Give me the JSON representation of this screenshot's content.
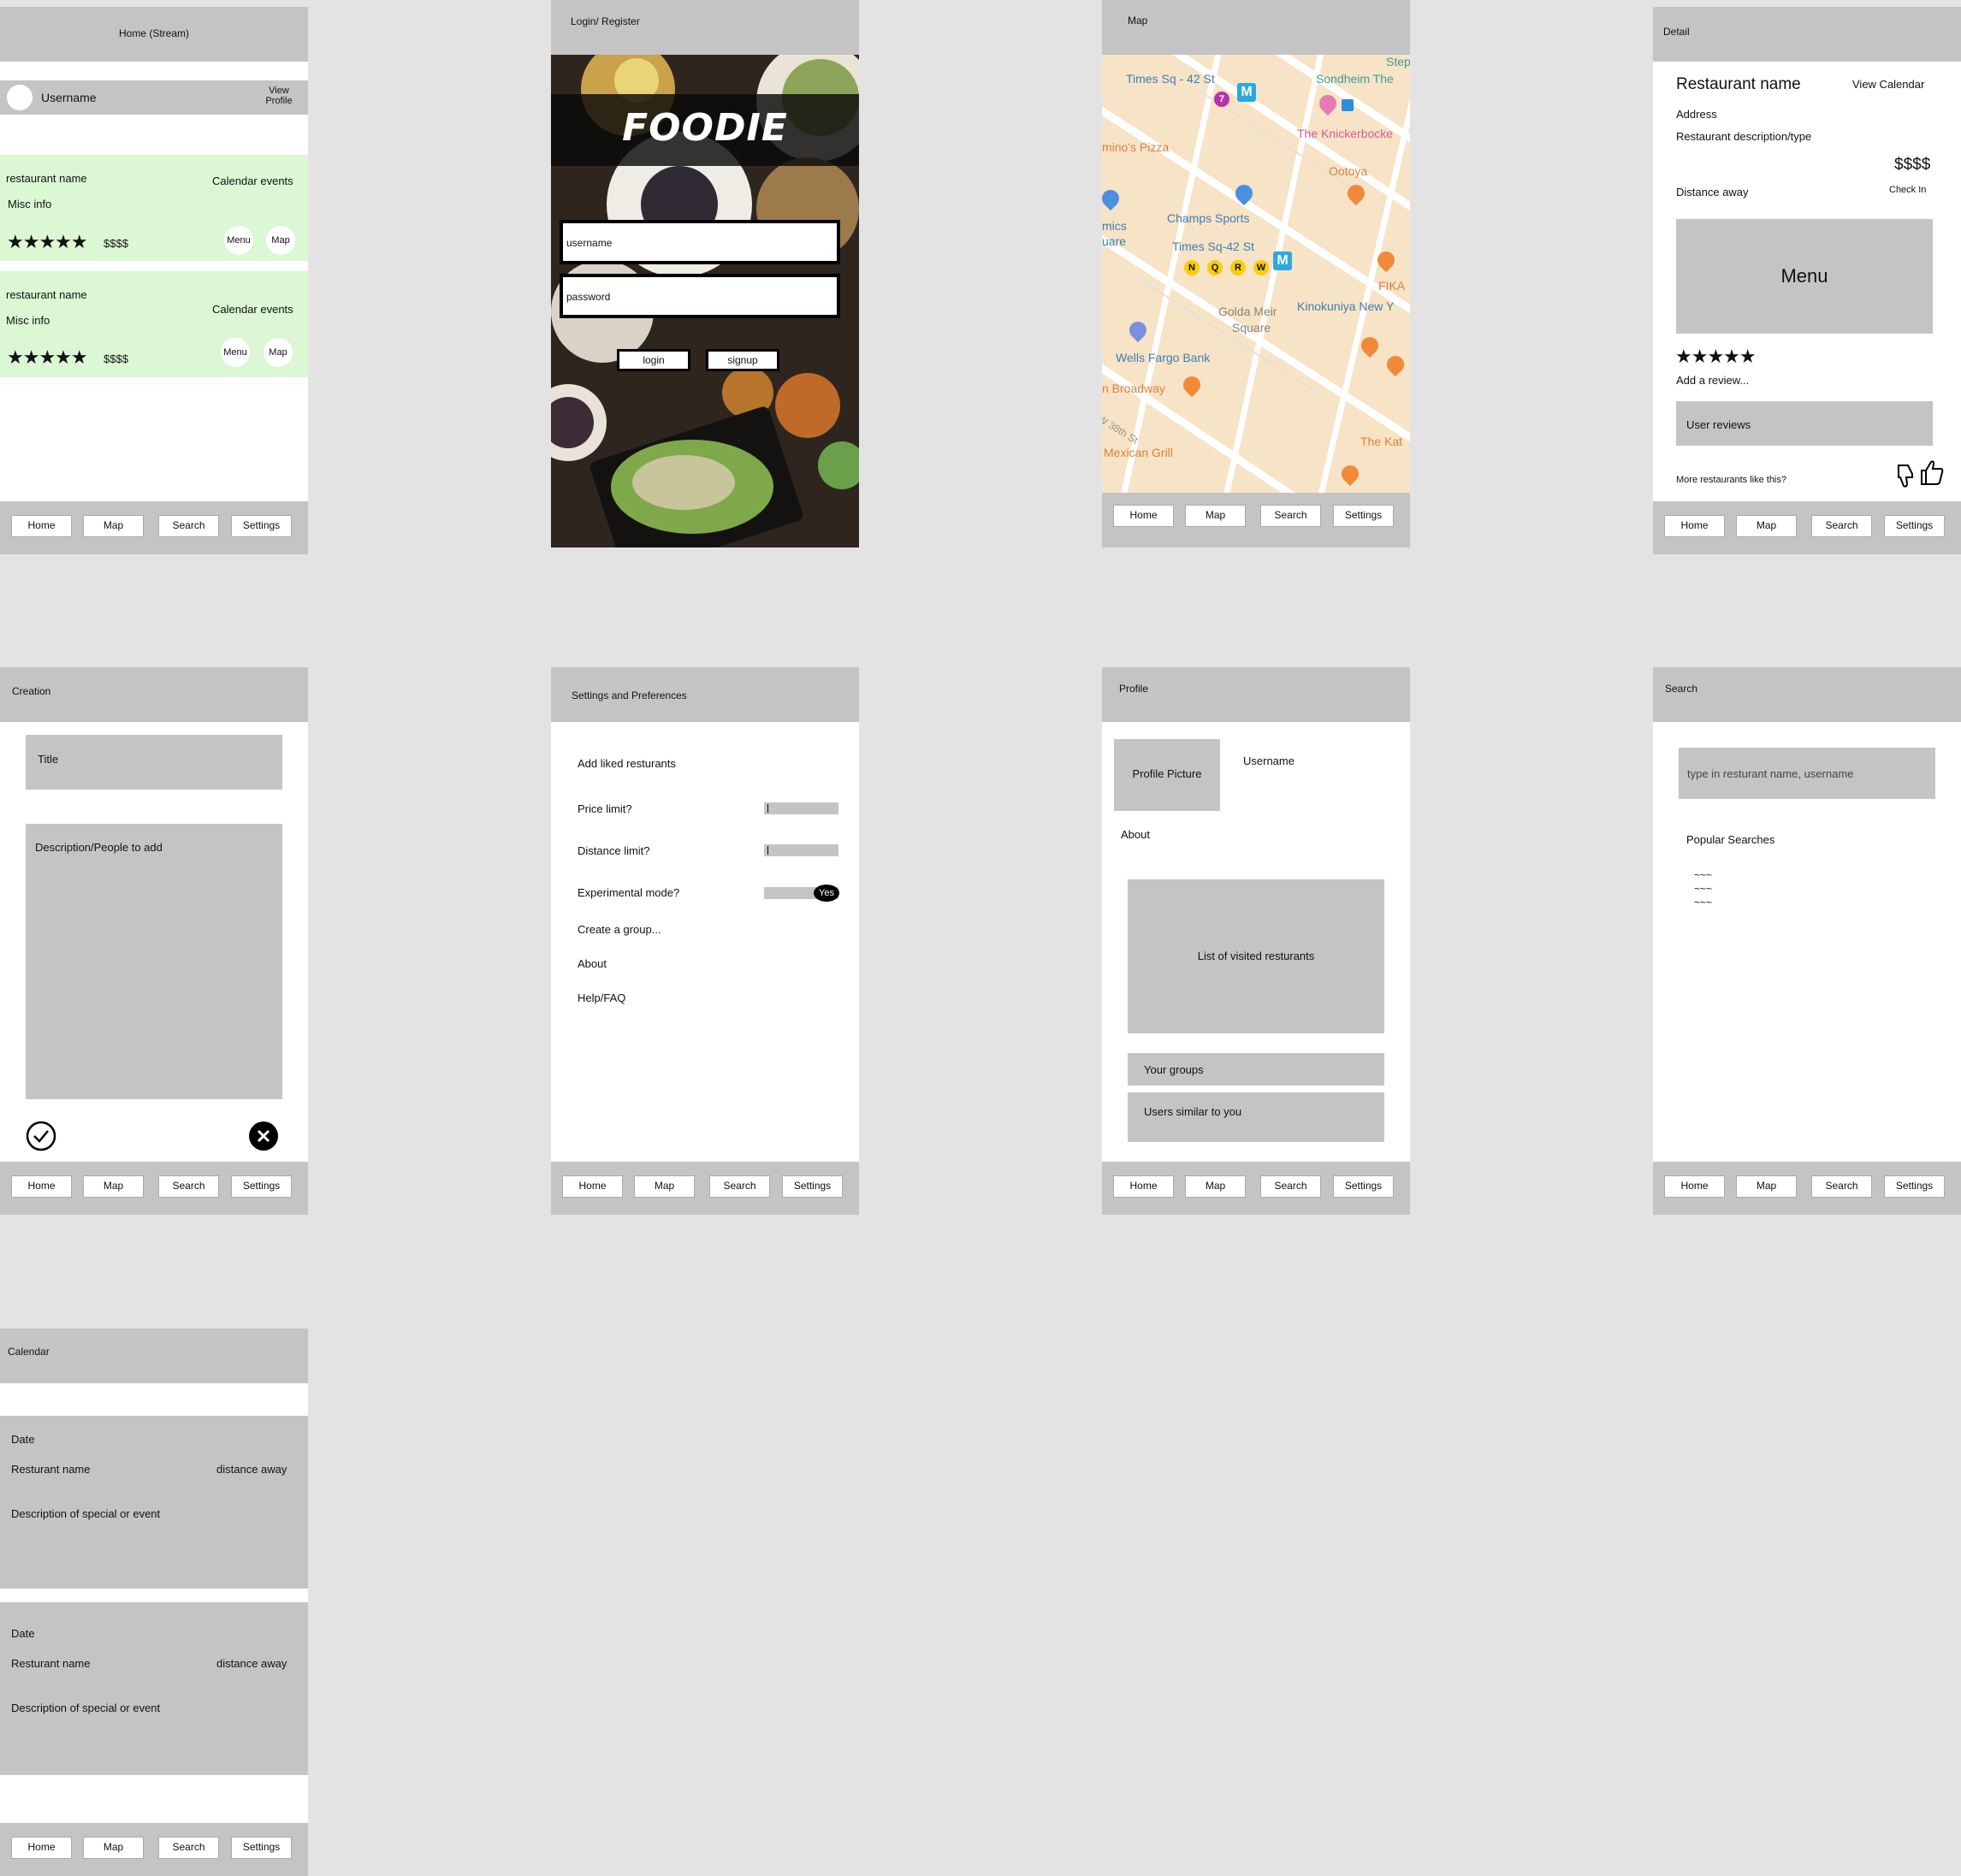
{
  "nav": {
    "home": "Home",
    "map": "Map",
    "search": "Search",
    "settings": "Settings"
  },
  "home": {
    "title": "Home (Stream)",
    "username": "Username",
    "view_profile": "View Profile",
    "cards": [
      {
        "name": "restaurant name",
        "calendar": "Calendar events",
        "misc": "Misc info",
        "stars": "★★★★★",
        "price": "$$$$",
        "menu": "Menu",
        "map": "Map"
      },
      {
        "name": "restaurant name",
        "calendar": "Calendar events",
        "misc": "Misc info",
        "stars": "★★★★★",
        "price": "$$$$",
        "menu": "Menu",
        "map": "Map"
      }
    ]
  },
  "login": {
    "title": "Login/ Register",
    "logo": "FOODIE",
    "username_placeholder": "username",
    "password_placeholder": "password",
    "login": "login",
    "signup": "signup"
  },
  "map": {
    "title": "Map",
    "labels": [
      "Times Sq - 42 St",
      "Sondheim The",
      "Step",
      "The Knickerbocke",
      "mino's Pizza",
      "Ootoya",
      "Champs Sports",
      "mics",
      "uare",
      "Times Sq-42 St",
      "FIKA",
      "Golda Meir",
      "Square",
      "Kinokuniya New Y",
      "Wells Fargo Bank",
      "n Broadway",
      "W 38th St",
      "The Kat",
      "Mexican Grill"
    ],
    "lines": [
      "N",
      "Q",
      "R",
      "W"
    ]
  },
  "detail": {
    "title": "Detail",
    "name": "Restaurant name",
    "view_calendar": "View Calendar",
    "address": "Address",
    "description": "Restaurant description/type",
    "price": "$$$$",
    "distance": "Distance away",
    "check_in": "Check In",
    "menu": "Menu",
    "stars": "★★★★★",
    "add_review": "Add a review...",
    "user_reviews": "User reviews",
    "more": "More restaurants like this?"
  },
  "creation": {
    "title": "Creation",
    "title_field": "Title",
    "desc_field": "Description/People to add"
  },
  "settings": {
    "title": "Settings and Preferences",
    "liked": "Add liked resturants",
    "price": "Price limit?",
    "distance": "Distance limit?",
    "experimental": "Experimental mode?",
    "toggle": "Yes",
    "group": "Create a group...",
    "about": "About",
    "help": "Help/FAQ"
  },
  "profile": {
    "title": "Profile",
    "picture": "Profile Picture",
    "username": "Username",
    "about": "About",
    "visited": "List of visited resturants",
    "groups": "Your groups",
    "similar": "Users similar to you"
  },
  "search": {
    "title": "Search",
    "placeholder": "type in resturant name, username",
    "popular": "Popular Searches",
    "items": [
      "~~~",
      "~~~",
      "~~~"
    ]
  },
  "calendar": {
    "title": "Calendar",
    "events": [
      {
        "date": "Date",
        "name": "Resturant name",
        "distance": "distance away",
        "desc": "Description of special or event"
      },
      {
        "date": "Date",
        "name": "Resturant name",
        "distance": "distance away",
        "desc": "Description of special or event"
      }
    ]
  }
}
